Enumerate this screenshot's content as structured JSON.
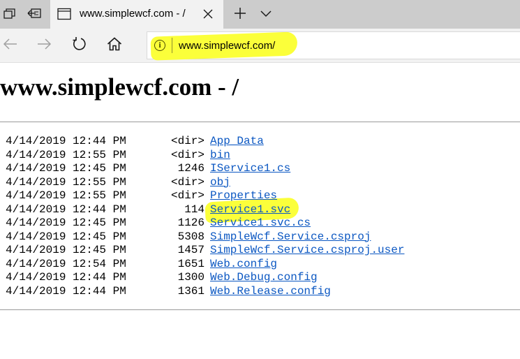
{
  "browser": {
    "tab_title": "www.simplewcf.com - /",
    "address": "www.simplewcf.com/",
    "info_glyph": "i",
    "icons": [
      "tab-preview-icon",
      "set-tabs-aside-icon",
      "page-icon",
      "close-tab-icon",
      "new-tab-icon",
      "tab-list-chevron-icon",
      "back-icon",
      "forward-icon",
      "refresh-icon",
      "home-icon",
      "site-info-icon"
    ],
    "highlight_color": "#fbff3a",
    "link_color": "#0b57c2"
  },
  "page": {
    "heading": "www.simplewcf.com - /",
    "entries": [
      {
        "date": "4/14/2019 12:44 PM",
        "size": "<dir>",
        "name": "App_Data"
      },
      {
        "date": "4/14/2019 12:55 PM",
        "size": "<dir>",
        "name": "bin"
      },
      {
        "date": "4/14/2019 12:45 PM",
        "size": "1246",
        "name": "IService1.cs"
      },
      {
        "date": "4/14/2019 12:55 PM",
        "size": "<dir>",
        "name": "obj"
      },
      {
        "date": "4/14/2019 12:55 PM",
        "size": "<dir>",
        "name": "Properties"
      },
      {
        "date": "4/14/2019 12:44 PM",
        "size": "114",
        "name": "Service1.svc"
      },
      {
        "date": "4/14/2019 12:45 PM",
        "size": "1126",
        "name": "Service1.svc.cs"
      },
      {
        "date": "4/14/2019 12:45 PM",
        "size": "5308",
        "name": "SimpleWcf.Service.csproj"
      },
      {
        "date": "4/14/2019 12:45 PM",
        "size": "1457",
        "name": "SimpleWcf.Service.csproj.user"
      },
      {
        "date": "4/14/2019 12:54 PM",
        "size": "1651",
        "name": "Web.config"
      },
      {
        "date": "4/14/2019 12:44 PM",
        "size": "1300",
        "name": "Web.Debug.config"
      },
      {
        "date": "4/14/2019 12:44 PM",
        "size": "1361",
        "name": "Web.Release.config"
      }
    ]
  }
}
